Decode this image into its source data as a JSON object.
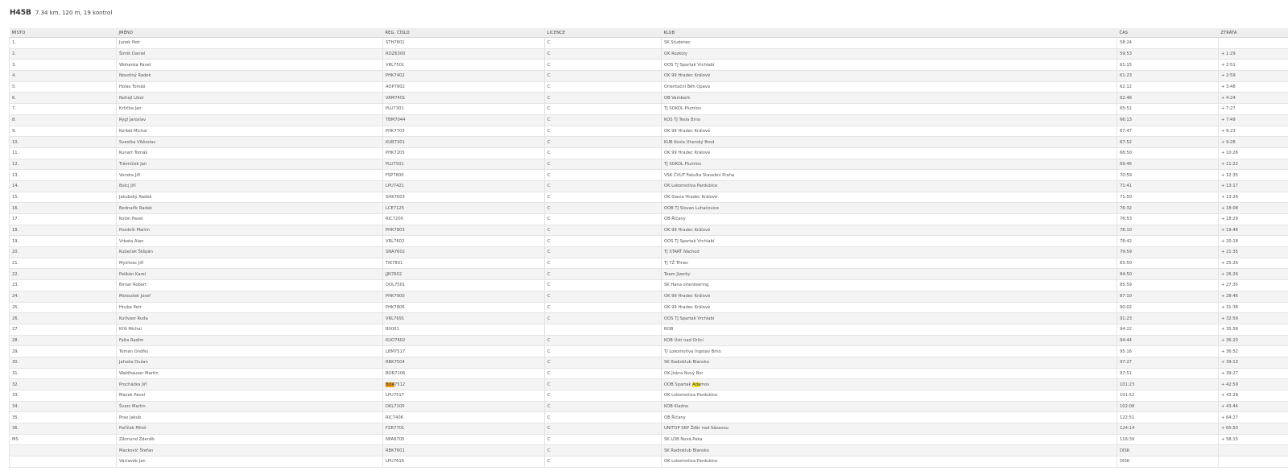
{
  "header": {
    "class_name": "H45B",
    "course_info": "7.34 km, 120 m, 19 kontrol"
  },
  "columns": [
    "MÍSTO",
    "JMÉNO",
    "REG. ČÍSLO",
    "LICENCE",
    "KLUB",
    "ČAS",
    "ZTRÁTA"
  ],
  "highlight": {
    "reg_prefix": "BOA",
    "club_fragment": "Ada"
  },
  "rows": [
    [
      "1.",
      "Junek Petr",
      "STH7801",
      "C",
      "SK Studenec",
      "58:24",
      ""
    ],
    [
      "2.",
      "Šimik Daniel",
      "ROZ6300",
      "C",
      "OK Rozkoly",
      "59:53",
      "+ 1:29"
    ],
    [
      "3.",
      "Wohanka Pavel",
      "VRL7501",
      "C",
      "OOS TJ Spartak Vrchlabí",
      "61:15",
      "+ 2:51"
    ],
    [
      "4.",
      "Novotný Radek",
      "PHK7402",
      "C",
      "OK 99 Hradec Králové",
      "61:23",
      "+ 2:59"
    ],
    [
      "5.",
      "Holas Tomáš",
      "AOP7802",
      "C",
      "Orientační Běh Opava",
      "62:12",
      "+ 3:48"
    ],
    [
      "6.",
      "Nohejl Libor",
      "VAM7401",
      "C",
      "OB Vamberk",
      "62:48",
      "+ 4:24"
    ],
    [
      "7.",
      "Krtička Jan",
      "PLU7301",
      "C",
      "TJ SOKOL Plumlov",
      "65:51",
      "+ 7:27"
    ],
    [
      "8.",
      "Rygl Jaroslav",
      "TBM7044",
      "C",
      "KOS TJ Tesla Brno",
      "66:13",
      "+ 7:49"
    ],
    [
      "9.",
      "Korbel Michal",
      "PHK7703",
      "C",
      "OK 99 Hradec Králové",
      "67:47",
      "+ 9:23"
    ],
    [
      "10.",
      "Svestka Vítězslav",
      "KUB7301",
      "C",
      "KUB Kosla Uherský Brod",
      "67:52",
      "+ 9:28"
    ],
    [
      "11.",
      "Kunart Tomáš",
      "PHK7205",
      "C",
      "OK 99 Hradec Králové",
      "68:50",
      "+ 10:26"
    ],
    [
      "12.",
      "Trávníček Jan",
      "PLU7501",
      "C",
      "TJ SOKOL Plumlov",
      "69:46",
      "+ 11:22"
    ],
    [
      "13.",
      "Vondra Jiří",
      "FSP7600",
      "C",
      "VSK ČVUT Fakulta Stavební Praha",
      "70:59",
      "+ 12:35"
    ],
    [
      "14.",
      "Bolcj Jiří",
      "LPU7421",
      "C",
      "OK Lokomotiva Pardubice",
      "71:41",
      "+ 13:17"
    ],
    [
      "15.",
      "Jakubský Radek",
      "SHK7603",
      "C",
      "OK Slavia Hradec Králové",
      "71:50",
      "+ 13:26"
    ],
    [
      "16.",
      "Bednařík Radek",
      "LCE7125",
      "C",
      "OOB TJ Slovan Luhačovice",
      "76:32",
      "+ 18:08"
    ],
    [
      "17.",
      "Kolon Pavel",
      "RIC7200",
      "C",
      "OB Říčany",
      "76:53",
      "+ 18:29"
    ],
    [
      "18.",
      "Pozdník Martin",
      "PHK7803",
      "C",
      "OK 99 Hradec Králové",
      "78:10",
      "+ 19:46"
    ],
    [
      "19.",
      "Vrbata Alan",
      "VRL7602",
      "C",
      "OOS TJ Spartak Vrchlabí",
      "78:42",
      "+ 20:18"
    ],
    [
      "20.",
      "Kubeček Štěpán",
      "SNA7602",
      "C",
      "TJ START Náchod",
      "79:59",
      "+ 21:35"
    ],
    [
      "21.",
      "Myslivec Jiří",
      "TIK7801",
      "C",
      "TJ TŽ Třinec",
      "83:50",
      "+ 25:26"
    ],
    [
      "22.",
      "Pelikán Karel",
      "JJN7602",
      "C",
      "Team Jizerky",
      "84:50",
      "+ 26:26"
    ],
    [
      "23.",
      "Bimar Robert",
      "DOL7501",
      "C",
      "SK Hana orienteering",
      "85:59",
      "+ 27:35"
    ],
    [
      "24.",
      "Motoušek Josef",
      "PHK7900",
      "C",
      "OK 99 Hradec Králové",
      "87:10",
      "+ 28:46"
    ],
    [
      "25.",
      "Hruba Petr",
      "PHK7806",
      "C",
      "OK 99 Hradec Králové",
      "90:02",
      "+ 31:38"
    ],
    [
      "26.",
      "Kutlvasr Ruda",
      "VRL7691",
      "C",
      "OOS TJ Spartak Vrchlabí",
      "91:23",
      "+ 32:59"
    ],
    [
      "27.",
      "Kříž Michal",
      "B0001",
      "",
      "ROB",
      "94:22",
      "+ 35:58"
    ],
    [
      "28.",
      "Falta Radim",
      "KUO7602",
      "C",
      "KOB Ústí nad Orlicí",
      "94:44",
      "+ 36:20"
    ],
    [
      "29.",
      "Toman Ondřej",
      "LBM7517",
      "C",
      "TJ Lokomotiva Ingstav Brno",
      "95:16",
      "+ 36:52"
    ],
    [
      "30.",
      "Jahoda Dušan",
      "RBK7504",
      "C",
      "SK Radioklub Blansko",
      "97:27",
      "+ 39:13"
    ],
    [
      "31.",
      "Waldhauser Martin",
      "BOR7106",
      "C",
      "OK Jiskra Nový Bor",
      "97:51",
      "+ 39:27"
    ],
    [
      "32.",
      "Procházka Jiří",
      "BOA7512",
      "C",
      "OOB Spartak Adamov",
      "101:23",
      "+ 42:59"
    ],
    [
      "33.",
      "Macek Pavel",
      "LPU7517",
      "C",
      "OK Lokomotiva Pardubice",
      "101:52",
      "+ 43:28"
    ],
    [
      "34.",
      "Švarc Martin",
      "DKL7100",
      "C",
      "KOB Kladno",
      "102:08",
      "+ 43:44"
    ],
    [
      "35.",
      "Prax Jakub",
      "RIC7406",
      "C",
      "OB Říčany",
      "122:51",
      "+ 64:27"
    ],
    [
      "36.",
      "Paříček Miloš",
      "FZR7701",
      "C",
      "UNITOP SKP Žďár nad Sázavou",
      "124:14",
      "+ 65:50"
    ],
    [
      "MS",
      "Zikmund Zdeněk",
      "NPA6705",
      "C",
      "SK LOB Nová Paka",
      "116:39",
      "+ 58:15"
    ],
    [
      "",
      "Mackovič Štefan",
      "RBK7601",
      "C",
      "SK Radioklub Blansko",
      "DISK",
      ""
    ],
    [
      "",
      "Václavek Jan",
      "LPU7616",
      "C",
      "OK Lokomotiva Pardubice",
      "DISK",
      ""
    ]
  ]
}
